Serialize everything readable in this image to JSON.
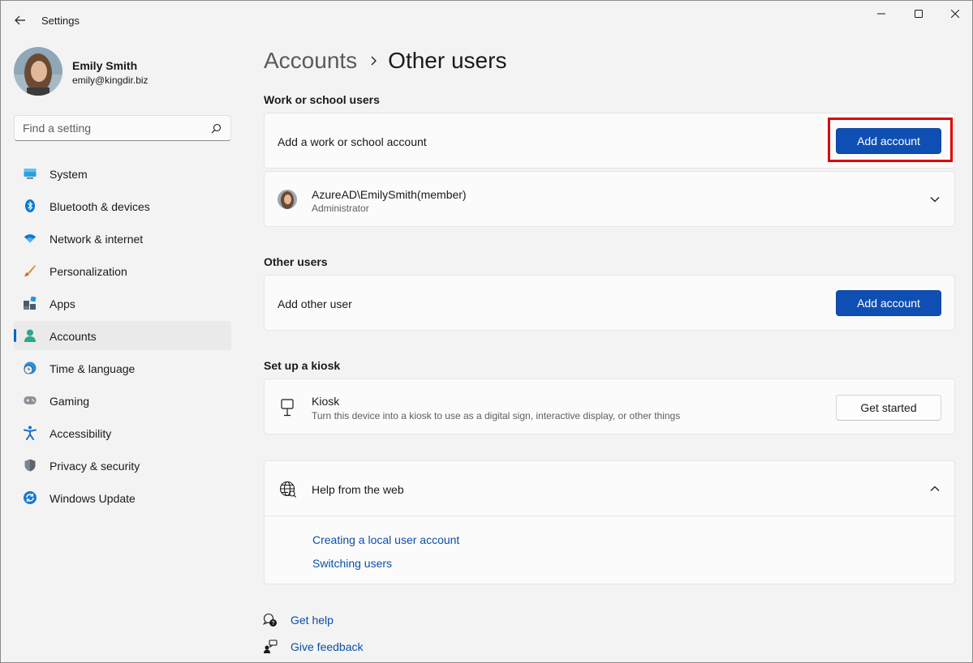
{
  "window": {
    "title": "Settings"
  },
  "profile": {
    "name": "Emily Smith",
    "email": "emily@kingdir.biz"
  },
  "search": {
    "placeholder": "Find a setting"
  },
  "sidebar": {
    "items": [
      {
        "label": "System",
        "icon": "system-icon"
      },
      {
        "label": "Bluetooth & devices",
        "icon": "bluetooth-icon"
      },
      {
        "label": "Network & internet",
        "icon": "wifi-icon"
      },
      {
        "label": "Personalization",
        "icon": "brush-icon"
      },
      {
        "label": "Apps",
        "icon": "apps-icon"
      },
      {
        "label": "Accounts",
        "icon": "person-icon",
        "active": true
      },
      {
        "label": "Time & language",
        "icon": "clock-globe-icon"
      },
      {
        "label": "Gaming",
        "icon": "gamepad-icon"
      },
      {
        "label": "Accessibility",
        "icon": "accessibility-icon"
      },
      {
        "label": "Privacy & security",
        "icon": "shield-icon"
      },
      {
        "label": "Windows Update",
        "icon": "update-icon"
      }
    ]
  },
  "breadcrumb": {
    "parent": "Accounts",
    "current": "Other users"
  },
  "work_school": {
    "title": "Work or school users",
    "add_label": "Add a work or school account",
    "add_button": "Add account",
    "account_name": "AzureAD\\EmilySmith(member)",
    "account_role": "Administrator"
  },
  "other_users": {
    "title": "Other users",
    "add_label": "Add other user",
    "add_button": "Add account"
  },
  "kiosk": {
    "title": "Set up a kiosk",
    "label": "Kiosk",
    "description": "Turn this device into a kiosk to use as a digital sign, interactive display, or other things",
    "button": "Get started"
  },
  "help": {
    "title": "Help from the web",
    "links": [
      "Creating a local user account",
      "Switching users"
    ]
  },
  "footer": {
    "get_help": "Get help",
    "give_feedback": "Give feedback"
  },
  "colors": {
    "accent": "#0f4fb4",
    "link": "#0b4fa8",
    "highlight": "#e00000",
    "nav_indicator": "#0067c0"
  }
}
